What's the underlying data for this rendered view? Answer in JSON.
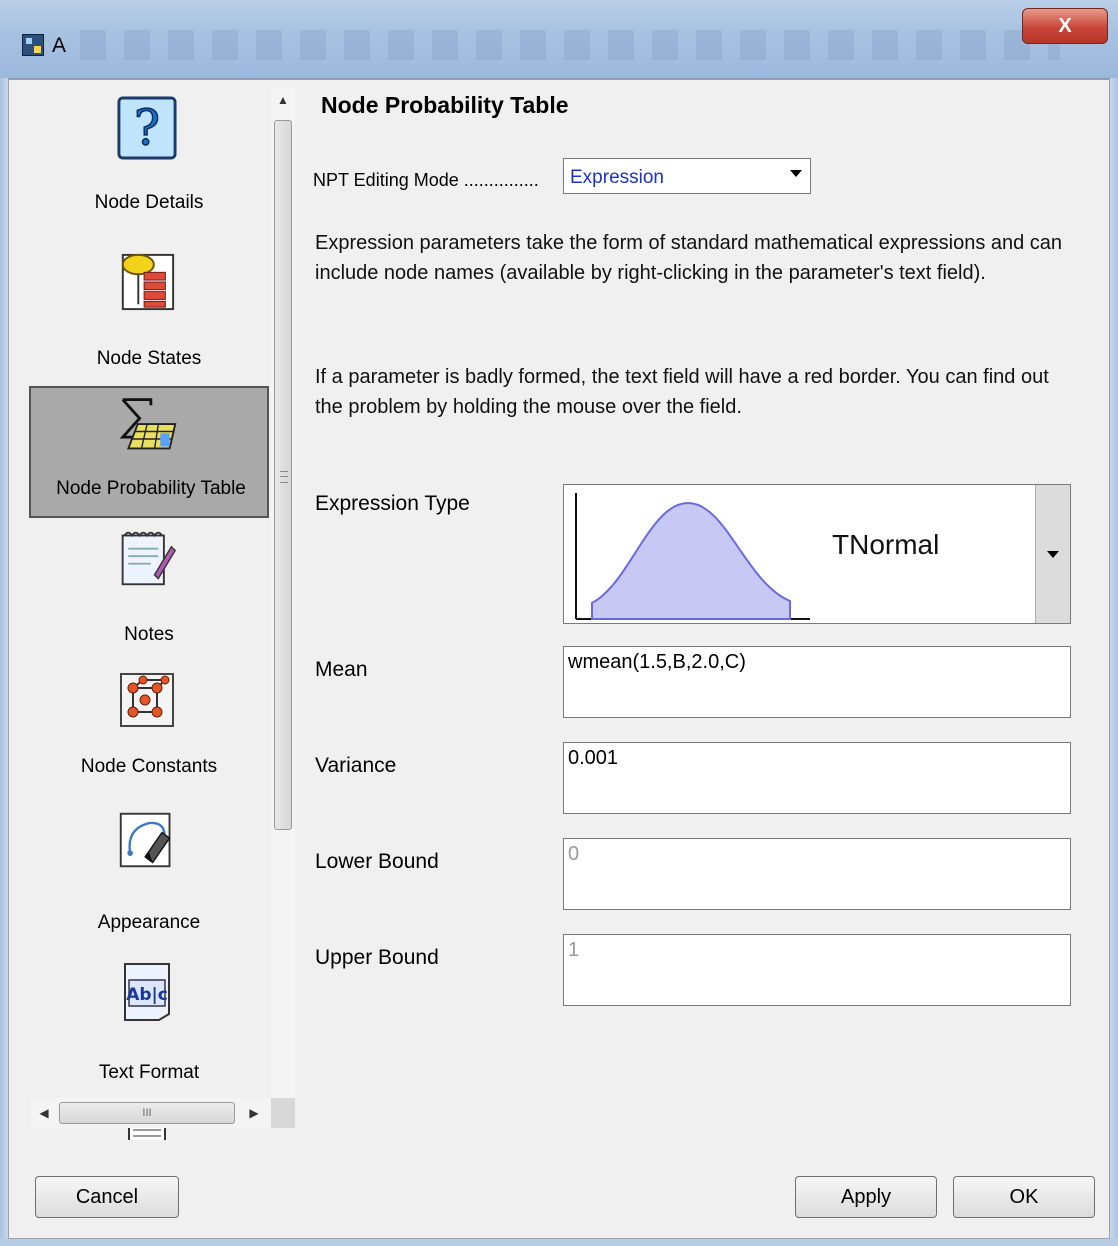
{
  "window": {
    "title": "A",
    "close_label": "X"
  },
  "sidebar": {
    "items": [
      {
        "label": "Node Details",
        "icon": "help-question-icon",
        "selected": false
      },
      {
        "label": "Node States",
        "icon": "node-states-icon",
        "selected": false
      },
      {
        "label": "Node Probability Table",
        "icon": "probability-table-icon",
        "selected": true
      },
      {
        "label": "Notes",
        "icon": "notes-icon",
        "selected": false
      },
      {
        "label": "Node Constants",
        "icon": "node-constants-icon",
        "selected": false
      },
      {
        "label": "Appearance",
        "icon": "appearance-icon",
        "selected": false
      },
      {
        "label": "Text Format",
        "icon": "text-format-icon",
        "selected": false
      },
      {
        "label": "",
        "icon": "document-icon",
        "selected": false
      }
    ],
    "hscroll_grip": "III"
  },
  "panel": {
    "title": "Node Probability Table",
    "mode_label": "NPT Editing Mode ...............",
    "mode_value": "Expression",
    "description_1": "Expression parameters take the form of standard mathematical expressions and can include node names (available by right-clicking in the parameter's text field).",
    "description_2": "If a parameter is badly formed, the text field will have a red border. You can find out the problem by holding the mouse over the field.",
    "expression_type_label": "Expression Type",
    "expression_type_value": "TNormal",
    "fields": {
      "mean_label": "Mean",
      "mean_value": "wmean(1.5,B,2.0,C)",
      "variance_label": "Variance",
      "variance_value": "0.001",
      "lower_label": "Lower Bound",
      "lower_value": "0",
      "upper_label": "Upper Bound",
      "upper_value": "1"
    }
  },
  "buttons": {
    "cancel": "Cancel",
    "apply": "Apply",
    "ok": "OK"
  },
  "colors": {
    "mode_value": "#1a33cc",
    "selected_item_bg": "#a9a9a9",
    "curve_fill": "#c8c8f5",
    "curve_stroke": "#6a6ae0"
  }
}
